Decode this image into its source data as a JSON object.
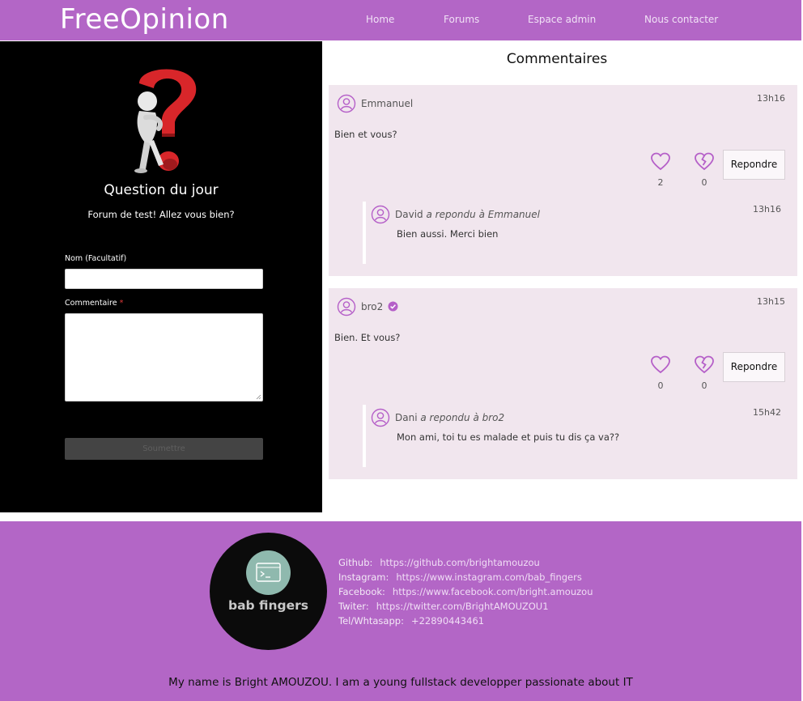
{
  "nav": {
    "brand": "FreeOpinion",
    "links": [
      "Home",
      "Forums",
      "Espace admin",
      "Nous contacter"
    ]
  },
  "question": {
    "title": "Question du jour",
    "subtitle": "Forum de test! Allez vous bien?"
  },
  "form": {
    "name_label": "Nom (Facultatif)",
    "comment_label": "Commentaire",
    "required_mark": "*",
    "name_value": "",
    "comment_value": "",
    "submit_label": "Soumettre"
  },
  "comments_title": "Commentaires",
  "comments": [
    {
      "author": "Emmanuel",
      "time": "13h16",
      "text": "Bien et vous?",
      "verified": false,
      "likes": "2",
      "dislikes": "0",
      "reply_label": "Repondre",
      "reply": {
        "author": "David",
        "action": "a repondu à Emmanuel",
        "time": "13h16",
        "text": "Bien aussi. Merci bien"
      }
    },
    {
      "author": "bro2",
      "time": "13h15",
      "text": "Bien. Et vous?",
      "verified": true,
      "likes": "0",
      "dislikes": "0",
      "reply_label": "Repondre",
      "reply": {
        "author": "Dani",
        "action": "a repondu à bro2",
        "time": "15h42",
        "text": "Mon ami, toi tu es malade et puis tu dis ça va??"
      }
    }
  ],
  "footer": {
    "logo_text": "bab fingers",
    "socials": [
      {
        "label": "Github:",
        "value": "https://github.com/brightamouzou"
      },
      {
        "label": "Instagram:",
        "value": "https://www.instagram.com/bab_fingers"
      },
      {
        "label": "Facebook:",
        "value": "https://www.facebook.com/bright.amouzou"
      },
      {
        "label": "Twiter:",
        "value": "https://twitter.com/BrightAMOUZOU1"
      },
      {
        "label": "Tel/Whtasapp:",
        "value": "+22890443461"
      }
    ],
    "bio": "My name is Bright AMOUZOU. I am a young fullstack developper passionate about IT"
  },
  "colors": {
    "accent": "#b366c6",
    "card_bg": "#f1e6ee",
    "icon": "#b55fc8",
    "panel": "#000000"
  },
  "icons": {
    "like": "heart-icon",
    "dislike": "broken-heart-icon",
    "user": "user-circle-icon",
    "verified": "verified-check-icon"
  }
}
